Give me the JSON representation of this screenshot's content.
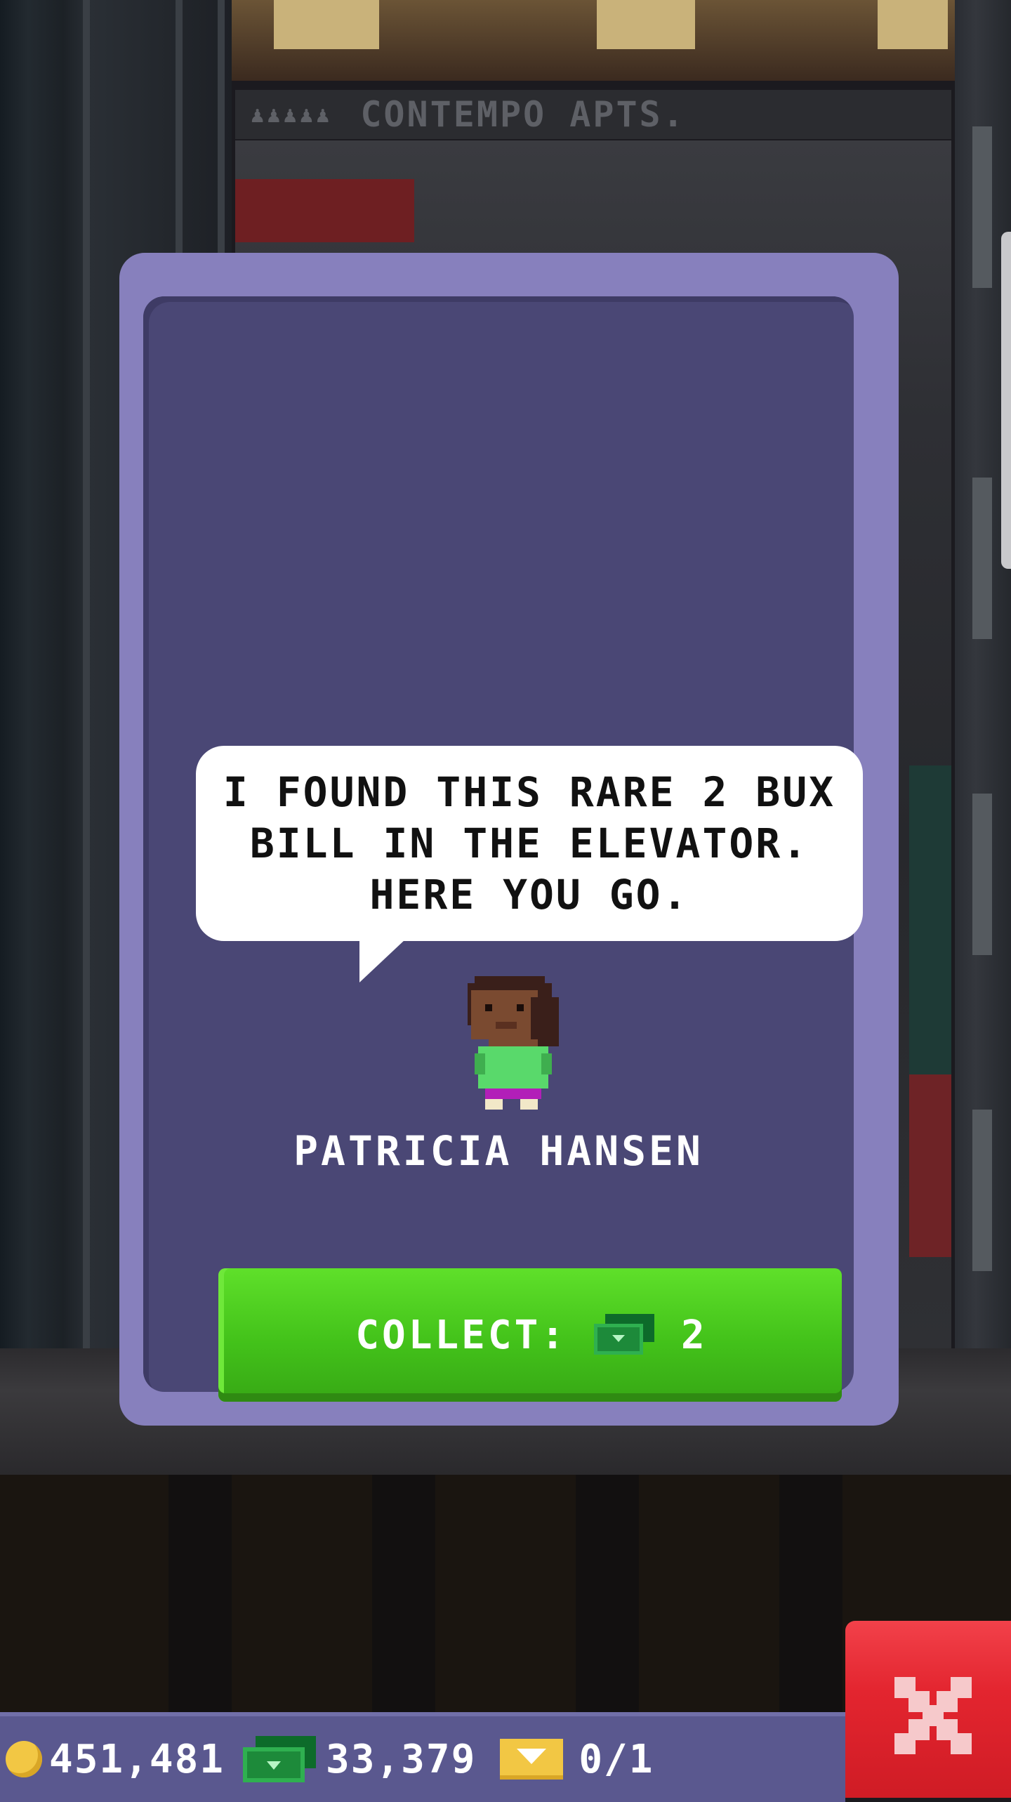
{
  "background": {
    "building_sign": "CONTEMPO APTS."
  },
  "dialog": {
    "message": "I FOUND THIS RARE 2 BUX BILL IN THE ELEVATOR. HERE YOU GO.",
    "character_name": "PATRICIA HANSEN",
    "collect_label": "COLLECT:",
    "collect_amount": "2",
    "reward_icon": "bux-icon"
  },
  "hud": {
    "coins": "451,481",
    "bux": "33,379",
    "tickets": "0/1",
    "icons": [
      "coin-icon",
      "bux-icon",
      "golden-ticket-icon"
    ]
  },
  "close_button": {
    "icon": "close-icon"
  },
  "colors": {
    "card_border": "#8780bd",
    "card_fill": "#4a4775",
    "collect_green": "#43c21a",
    "close_red": "#e3252f",
    "hud_bar": "#5a588f"
  }
}
